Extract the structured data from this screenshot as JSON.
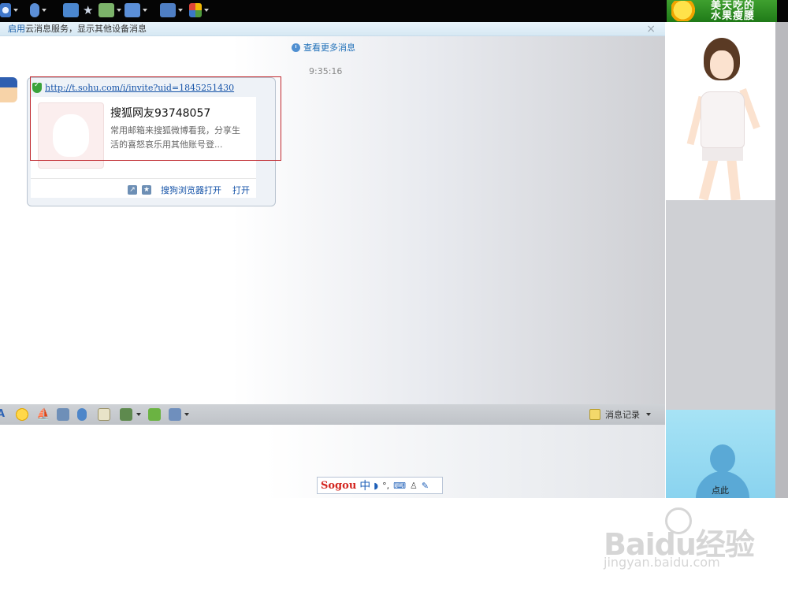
{
  "toolbar": {
    "ad_text_line1": "美天吃的",
    "ad_text_line2": "水果瘦腰"
  },
  "notification": {
    "enable": "启用",
    "text": "云消息服务，显示其他设备消息",
    "close": "×"
  },
  "chat": {
    "more_messages": "查看更多消息",
    "time": "9:35:16",
    "message": {
      "link": "http://t.sohu.com/i/invite?uid=1845251430",
      "card_title": "搜狐网友93748057",
      "card_description": "常用邮箱来搜狐微博看我，分享生活的喜怒哀乐用其他账号登...",
      "open_in_sogou": "搜狗浏览器打开",
      "open": "打开"
    }
  },
  "input_toolbar": {
    "history": "消息记录"
  },
  "ime": {
    "logo": "Sogou",
    "mode": "中",
    "punct": "°,"
  },
  "self_avatar": {
    "label": "点此"
  },
  "watermark": {
    "brand": "Baidu经验",
    "url": "jingyan.baidu.com"
  }
}
